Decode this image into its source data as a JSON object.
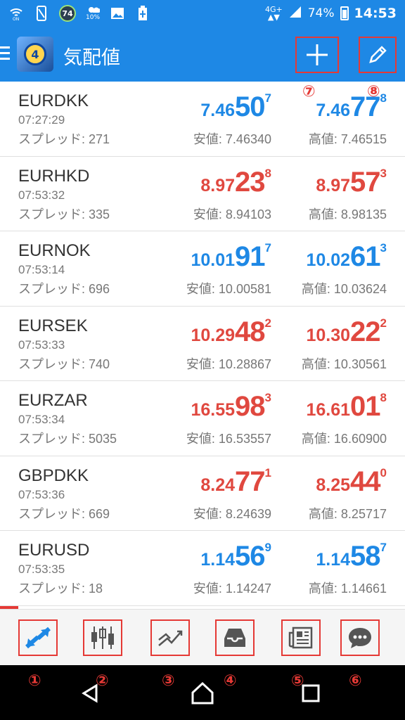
{
  "status_bar": {
    "badge_value": "74",
    "weather_percent": "10%",
    "network": "4G+",
    "battery_percent": "74%",
    "time": "14:53"
  },
  "app_bar": {
    "title": "気配値"
  },
  "annotations": {
    "add": "⑦",
    "edit": "⑧",
    "nav": [
      "①",
      "②",
      "③",
      "④",
      "⑤",
      "⑥"
    ]
  },
  "quotes": [
    {
      "symbol": "EURDKK",
      "time": "07:27:29",
      "spread": "スプレッド: 271",
      "bid": {
        "pre": "7.46",
        "big": "50",
        "sup": "7",
        "color": "blue"
      },
      "ask": {
        "pre": "7.46",
        "big": "77",
        "sup": "8",
        "color": "blue"
      },
      "low": "安値: 7.46340",
      "high": "高値: 7.46515"
    },
    {
      "symbol": "EURHKD",
      "time": "07:53:32",
      "spread": "スプレッド: 335",
      "bid": {
        "pre": "8.97",
        "big": "23",
        "sup": "8",
        "color": "red"
      },
      "ask": {
        "pre": "8.97",
        "big": "57",
        "sup": "3",
        "color": "red"
      },
      "low": "安値: 8.94103",
      "high": "高値: 8.98135"
    },
    {
      "symbol": "EURNOK",
      "time": "07:53:14",
      "spread": "スプレッド: 696",
      "bid": {
        "pre": "10.01",
        "big": "91",
        "sup": "7",
        "color": "blue"
      },
      "ask": {
        "pre": "10.02",
        "big": "61",
        "sup": "3",
        "color": "blue"
      },
      "low": "安値: 10.00581",
      "high": "高値: 10.03624"
    },
    {
      "symbol": "EURSEK",
      "time": "07:53:33",
      "spread": "スプレッド: 740",
      "bid": {
        "pre": "10.29",
        "big": "48",
        "sup": "2",
        "color": "red"
      },
      "ask": {
        "pre": "10.30",
        "big": "22",
        "sup": "2",
        "color": "red"
      },
      "low": "安値: 10.28867",
      "high": "高値: 10.30561"
    },
    {
      "symbol": "EURZAR",
      "time": "07:53:34",
      "spread": "スプレッド: 5035",
      "bid": {
        "pre": "16.55",
        "big": "98",
        "sup": "3",
        "color": "red"
      },
      "ask": {
        "pre": "16.61",
        "big": "01",
        "sup": "8",
        "color": "red"
      },
      "low": "安値: 16.53557",
      "high": "高値: 16.60900"
    },
    {
      "symbol": "GBPDKK",
      "time": "07:53:36",
      "spread": "スプレッド: 669",
      "bid": {
        "pre": "8.24",
        "big": "77",
        "sup": "1",
        "color": "red"
      },
      "ask": {
        "pre": "8.25",
        "big": "44",
        "sup": "0",
        "color": "red"
      },
      "low": "安値: 8.24639",
      "high": "高値: 8.25717"
    },
    {
      "symbol": "EURUSD",
      "time": "07:53:35",
      "spread": "スプレッド: 18",
      "bid": {
        "pre": "1.14",
        "big": "56",
        "sup": "9",
        "color": "blue"
      },
      "ask": {
        "pre": "1.14",
        "big": "58",
        "sup": "7",
        "color": "blue"
      },
      "low": "安値: 1.14247",
      "high": "高値: 1.14661"
    }
  ],
  "bottom_nav": [
    {
      "name": "quotes-tab",
      "icon": "arrows-icon"
    },
    {
      "name": "chart-tab",
      "icon": "candlestick-icon"
    },
    {
      "name": "trade-tab",
      "icon": "trend-icon"
    },
    {
      "name": "history-tab",
      "icon": "inbox-icon"
    },
    {
      "name": "news-tab",
      "icon": "newspaper-icon"
    },
    {
      "name": "chat-tab",
      "icon": "chat-icon"
    }
  ],
  "colors": {
    "primary": "#1e88e5",
    "price_up": "#1e88e5",
    "price_down": "#e0483f",
    "annotation": "#e53935"
  }
}
